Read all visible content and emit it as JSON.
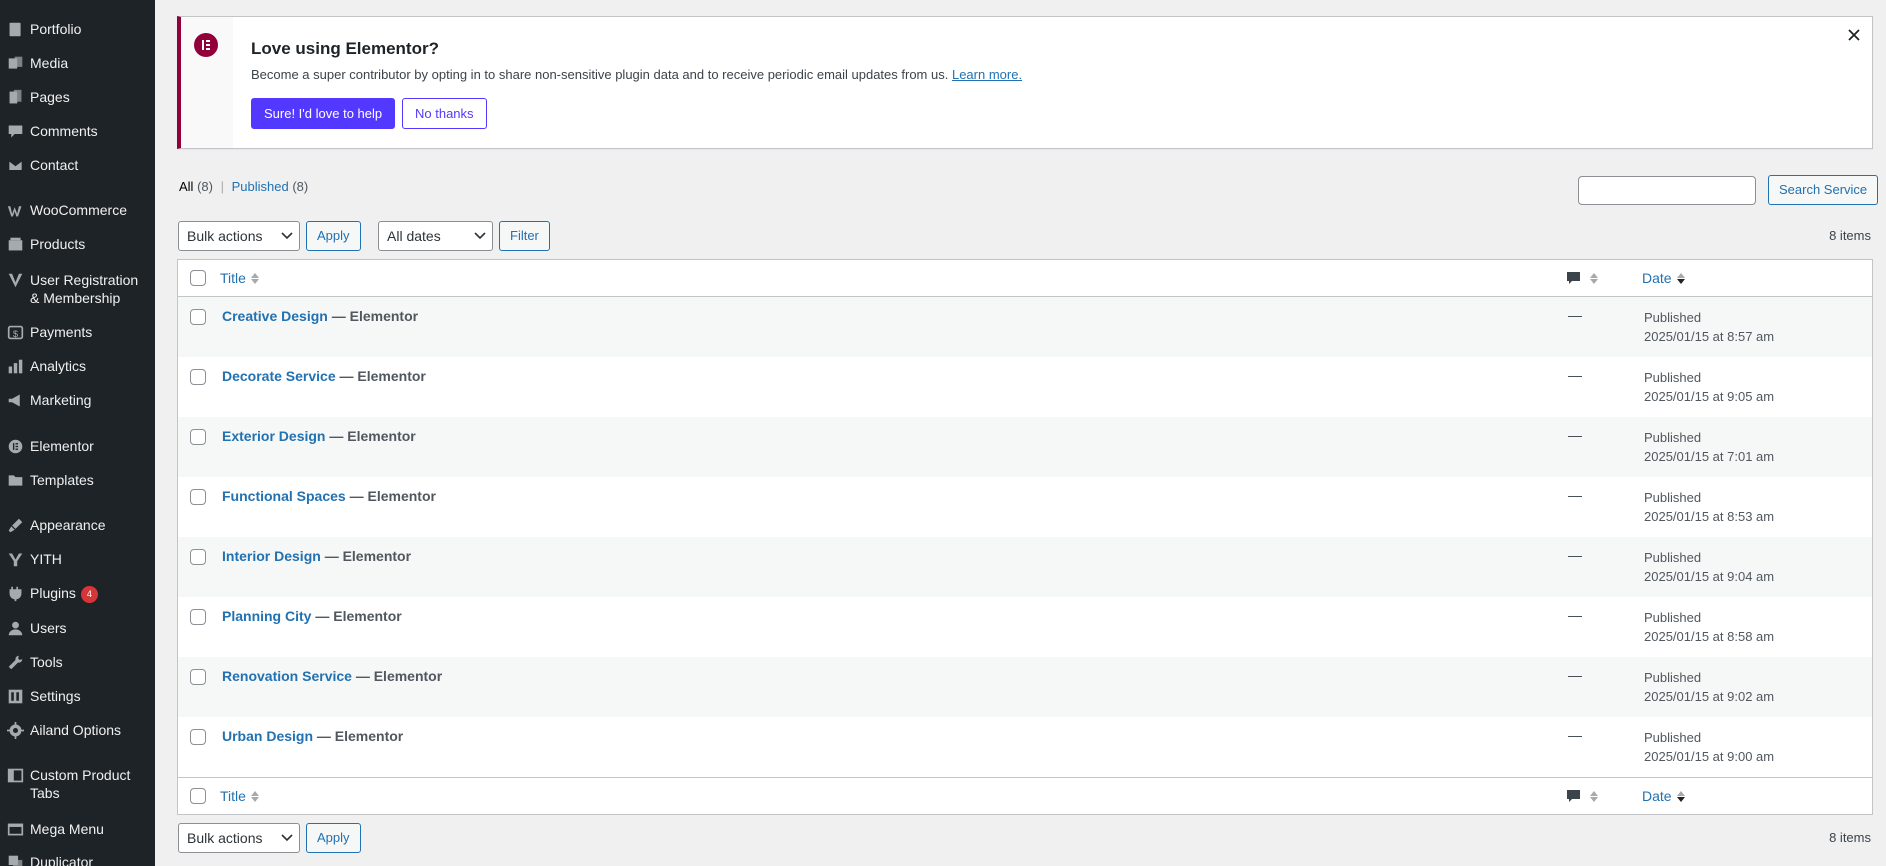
{
  "sidebar": {
    "items": [
      {
        "label": "Portfolio",
        "icon": "portfolio-icon"
      },
      {
        "label": "Media",
        "icon": "media-icon"
      },
      {
        "label": "Pages",
        "icon": "pages-icon"
      },
      {
        "label": "Comments",
        "icon": "comments-icon"
      },
      {
        "label": "Contact",
        "icon": "contact-icon"
      },
      {
        "label": "WooCommerce",
        "icon": "woocommerce-icon"
      },
      {
        "label": "Products",
        "icon": "products-icon"
      },
      {
        "label": "User Registration & Membership",
        "icon": "user-registration-icon"
      },
      {
        "label": "Payments",
        "icon": "payments-icon"
      },
      {
        "label": "Analytics",
        "icon": "analytics-icon"
      },
      {
        "label": "Marketing",
        "icon": "marketing-icon"
      },
      {
        "label": "Elementor",
        "icon": "elementor-icon"
      },
      {
        "label": "Templates",
        "icon": "templates-icon"
      },
      {
        "label": "Appearance",
        "icon": "appearance-icon"
      },
      {
        "label": "YITH",
        "icon": "yith-icon"
      },
      {
        "label": "Plugins",
        "icon": "plugins-icon",
        "badge": "4"
      },
      {
        "label": "Users",
        "icon": "users-icon"
      },
      {
        "label": "Tools",
        "icon": "tools-icon"
      },
      {
        "label": "Settings",
        "icon": "settings-icon"
      },
      {
        "label": "Ailand Options",
        "icon": "gear-icon"
      },
      {
        "label": "Custom Product Tabs",
        "icon": "custom-tabs-icon"
      },
      {
        "label": "Mega Menu",
        "icon": "mega-menu-icon"
      },
      {
        "label": "Duplicator",
        "icon": "duplicator-icon"
      }
    ]
  },
  "notice": {
    "title": "Love using Elementor?",
    "text": "Become a super contributor by opting in to share non-sensitive plugin data and to receive periodic email updates from us.",
    "link": "Learn more.",
    "primary_label": "Sure! I'd love to help",
    "secondary_label": "No thanks"
  },
  "filters": {
    "all_label": "All",
    "all_count": "(8)",
    "published_label": "Published",
    "published_count": "(8)"
  },
  "search": {
    "value": "",
    "button_label": "Search Service"
  },
  "toolbar": {
    "bulk_actions": "Bulk actions",
    "apply": "Apply",
    "all_dates": "All dates",
    "filter": "Filter",
    "items_count": "8 items"
  },
  "table": {
    "headers": {
      "title": "Title",
      "date": "Date"
    },
    "rows": [
      {
        "title": "Creative Design",
        "state": "— Elementor",
        "comments": "—",
        "status": "Published",
        "date": "2025/01/15 at 8:57 am"
      },
      {
        "title": "Decorate Service",
        "state": "— Elementor",
        "comments": "—",
        "status": "Published",
        "date": "2025/01/15 at 9:05 am"
      },
      {
        "title": "Exterior Design",
        "state": "— Elementor",
        "comments": "—",
        "status": "Published",
        "date": "2025/01/15 at 7:01 am"
      },
      {
        "title": "Functional Spaces",
        "state": "— Elementor",
        "comments": "—",
        "status": "Published",
        "date": "2025/01/15 at 8:53 am"
      },
      {
        "title": "Interior Design",
        "state": "— Elementor",
        "comments": "—",
        "status": "Published",
        "date": "2025/01/15 at 9:04 am"
      },
      {
        "title": "Planning City",
        "state": "— Elementor",
        "comments": "—",
        "status": "Published",
        "date": "2025/01/15 at 8:58 am"
      },
      {
        "title": "Renovation Service",
        "state": "— Elementor",
        "comments": "—",
        "status": "Published",
        "date": "2025/01/15 at 9:02 am"
      },
      {
        "title": "Urban Design",
        "state": "— Elementor",
        "comments": "—",
        "status": "Published",
        "date": "2025/01/15 at 9:00 am"
      }
    ]
  },
  "colors": {
    "sidebar_bg": "#1d2327",
    "link": "#2271b1",
    "elementor": "#92003b",
    "button_primary": "#5339ff"
  }
}
